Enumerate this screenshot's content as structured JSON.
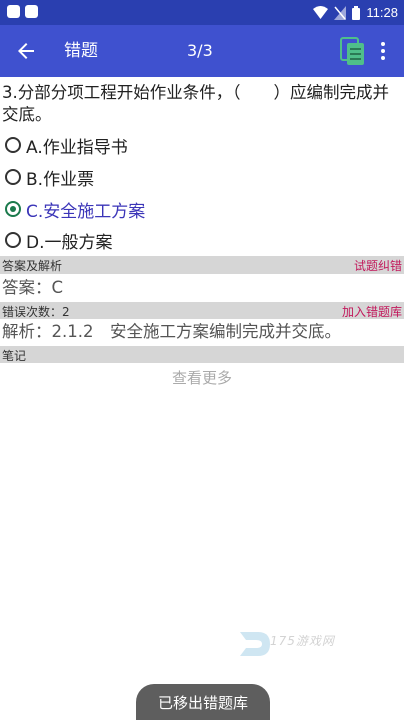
{
  "status_bar": {
    "time": "11:28"
  },
  "toolbar": {
    "title": "错题",
    "counter": "3/3"
  },
  "question": {
    "text": "3.分部分项工程开始作业条件，（　　）应编制完成并交底。"
  },
  "options": [
    {
      "label": "A.作业指导书",
      "selected": false
    },
    {
      "label": "B.作业票",
      "selected": false
    },
    {
      "label": "C.安全施工方案",
      "selected": true
    },
    {
      "label": "D.一般方案",
      "selected": false
    }
  ],
  "answer_section": {
    "header": "答案及解析",
    "report_link": "试题纠错",
    "answer": "答案：C"
  },
  "error_section": {
    "header": "错误次数：2",
    "add_link": "加入错题库",
    "analysis": "解析：2.1.2　安全施工方案编制完成并交底。"
  },
  "notes_section": {
    "header": "笔记",
    "see_more": "查看更多"
  },
  "watermark": {
    "text": "175游戏网"
  },
  "toast": {
    "text": "已移出错题库"
  },
  "colors": {
    "statusbar": "#2a3fb0",
    "toolbar": "#3f51cf",
    "accent_link": "#c2185b",
    "selected_option": "#3b35b8",
    "radio_selected": "#1b7a4c"
  }
}
